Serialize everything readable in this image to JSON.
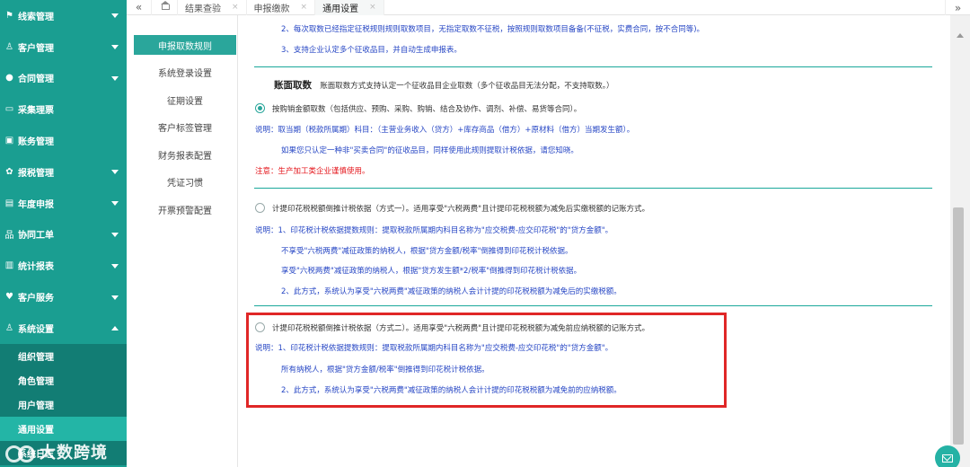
{
  "sidebar": {
    "items": [
      {
        "label": "线索管理",
        "icon": "flag-icon"
      },
      {
        "label": "客户管理",
        "icon": "user-icon"
      },
      {
        "label": "合同管理",
        "icon": "contract-icon"
      },
      {
        "label": "采集理票",
        "icon": "card-icon"
      },
      {
        "label": "账务管理",
        "icon": "ledger-icon"
      },
      {
        "label": "报税管理",
        "icon": "tax-icon"
      },
      {
        "label": "年度申报",
        "icon": "report-icon"
      },
      {
        "label": "协同工单",
        "icon": "org-icon"
      },
      {
        "label": "统计报表",
        "icon": "bar-chart-icon"
      },
      {
        "label": "客户服务",
        "icon": "heart-icon"
      },
      {
        "label": "系统设置",
        "icon": "person-icon"
      }
    ],
    "submenu": [
      "组织管理",
      "角色管理",
      "用户管理",
      "通用设置",
      "系统日志"
    ],
    "watermark": "大数跨境"
  },
  "tabs": {
    "items": [
      "结果查验",
      "申报缴款",
      "通用设置"
    ],
    "close_glyph": "×",
    "prev_glyph": "«",
    "next_glyph": "»"
  },
  "settings_nav": [
    "申报取数规则",
    "系统登录设置",
    "征期设置",
    "客户标签管理",
    "财务报表配置",
    "凭证习惯",
    "开票预警配置"
  ],
  "content": {
    "top_line1": "2、每次取数已经指定征税规则规则取数项目，无指定取数不征税，按照规则取数项目备备(不征税，实费合同，按不合同等)。",
    "top_line2": "3、支持企业认定多个征收品目，并自动生成申报表。",
    "section_title": "账面取数",
    "section_desc": "账面取数方式支持认定一个征收品目企业取数（多个征收品目无法分配，不支持取数。）",
    "opt1": {
      "label": "按购销金额取数（包括供应、预购、采购、购销、结合及协作、调剂、补偿、易货等合同）。",
      "desc1": "说明：取当期（税款所属期）科目：（主营业务收入（贷方）+库存商品（借方）+原材料（借方）当期发生额）。",
      "desc2": "如果您只认定一种非\"买卖合同\"的征收品目，同样使用此规则提取计税依据，请您知晓。",
      "note": "注意：生产加工类企业谨慎使用。"
    },
    "opt2": {
      "label": "计提印花税税额倒推计税依据（方式一）。适用享受\"六税两费\"且计提印花税税额为减免后实缴税额的记账方式。",
      "desc1": "说明：1、印花税计税依据提数规则：提取税款所属期内科目名称为\"应交税费-应交印花税\"的\"贷方金额\"。",
      "desc2": "不享受\"六税两费\"减征政策的纳税人，根据\"贷方金额/税率\"倒推得到印花税计税依据。",
      "desc3": "享受\"六税两费\"减征政策的纳税人，根据\"贷方发生额*2/税率\"倒推得到印花税计税依据。",
      "desc4": "2、此方式，系统认为享受\"六税两费\"减征政策的纳税人会计计提的印花税税额为减免后的实缴税额。"
    },
    "opt3": {
      "label": "计提印花税税额倒推计税依据（方式二）。适用享受\"六税两费\"且计提印花税税额为减免前应纳税额的记账方式。",
      "desc1": "说明：1、印花税计税依据提数规则：提取税款所属期内科目名称为\"应交税费-应交印花税\"的\"贷方金额\"。",
      "desc2": "所有纳税人，根据\"贷方金额/税率\"倒推得到印花税计税依据。",
      "desc3": "2、此方式，系统认为享受\"六税两费\"减征政策的纳税人会计计提的印花税税额为减免前的应纳税额。"
    }
  },
  "colors": {
    "sidebar": "#1a9e91",
    "accent": "#2aa69b",
    "highlight_border": "#e02727",
    "explain_blue": "#2646c4",
    "warning_red": "#e4151b"
  }
}
